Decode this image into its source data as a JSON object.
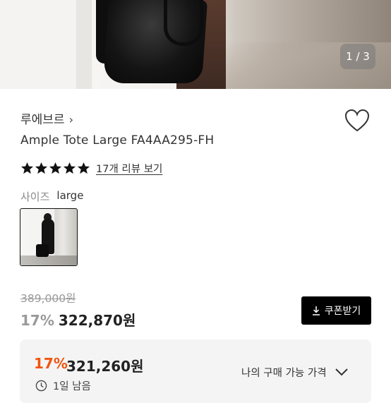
{
  "hero": {
    "counter": "1 / 3"
  },
  "product": {
    "brand": "루에브르",
    "name": "Ample Tote Large FA4AA295-FH",
    "rating_stars": 5,
    "review_link": "17개 리뷰 보기",
    "option_label": "사이즈",
    "option_value": "large"
  },
  "pricing": {
    "original_price": "389,000원",
    "discount_rate": "17%",
    "sale_price": "322,870원",
    "coupon_button": "쿠폰받기"
  },
  "my_price": {
    "discount_rate": "17%",
    "price": "321,260원",
    "label": "나의 구매 가능 가격",
    "time_left": "1일 남음"
  },
  "colors": {
    "accent_orange": "#f0550f",
    "button_black": "#000000",
    "muted_gray": "#999999"
  }
}
